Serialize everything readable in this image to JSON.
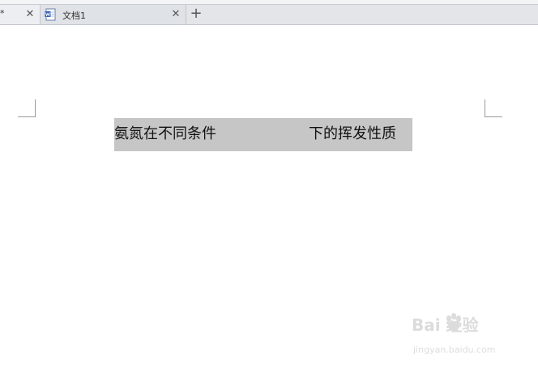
{
  "tabs": [
    {
      "label": "*",
      "close": "✕"
    },
    {
      "label": "文档1",
      "close": "✕",
      "icon": "word-document-icon"
    }
  ],
  "new_tab": {
    "label": "+"
  },
  "document": {
    "heading_part_1": "氨氮在不同条件",
    "heading_part_2": "下的挥发性质"
  },
  "watermark": {
    "main": "Bai  经验",
    "sub": "jingyan.baidu.com"
  },
  "colors": {
    "tabbar_bg": "#e3e5e8",
    "heading_highlight": "#c6c6c6",
    "page_bg": "#ffffff"
  }
}
